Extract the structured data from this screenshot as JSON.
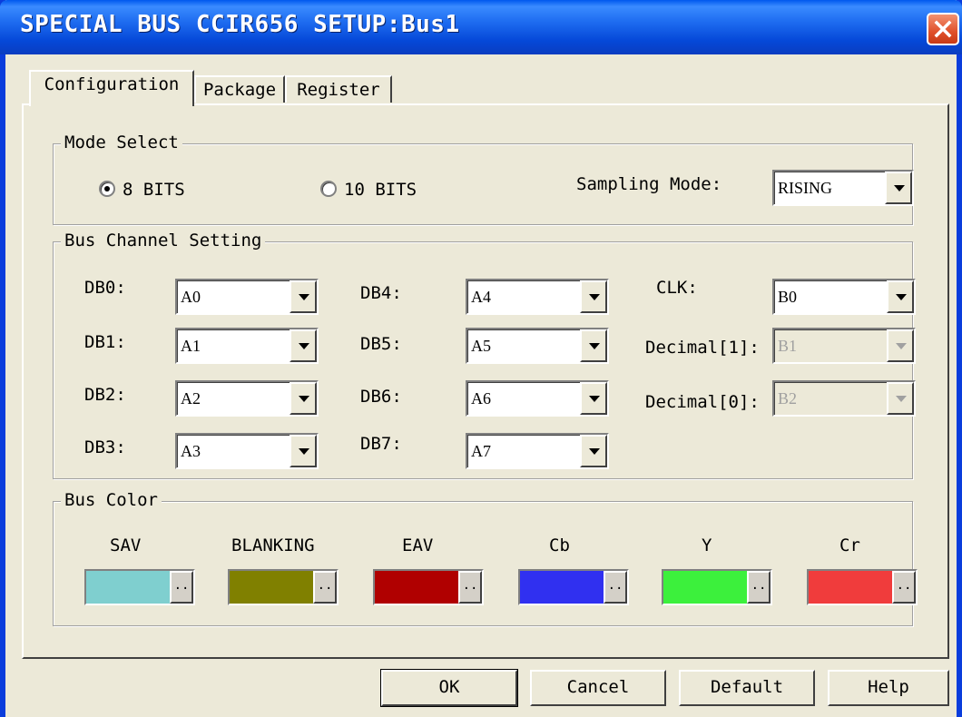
{
  "window": {
    "title": "SPECIAL BUS CCIR656 SETUP:Bus1"
  },
  "tabs": [
    "Configuration",
    "Package",
    "Register"
  ],
  "mode_select": {
    "group_label": "Mode Select",
    "radio_8": "8 BITS",
    "radio_10": "10 BITS",
    "selected": "8 BITS",
    "sampling_label": "Sampling Mode:",
    "sampling_value": "RISING"
  },
  "bus_channel": {
    "group_label": "Bus Channel Setting",
    "db0": {
      "label": "DB0:",
      "value": "A0"
    },
    "db1": {
      "label": "DB1:",
      "value": "A1"
    },
    "db2": {
      "label": "DB2:",
      "value": "A2"
    },
    "db3": {
      "label": "DB3:",
      "value": "A3"
    },
    "db4": {
      "label": "DB4:",
      "value": "A4"
    },
    "db5": {
      "label": "DB5:",
      "value": "A5"
    },
    "db6": {
      "label": "DB6:",
      "value": "A6"
    },
    "db7": {
      "label": "DB7:",
      "value": "A7"
    },
    "clk": {
      "label": "CLK:",
      "value": "B0"
    },
    "dec1": {
      "label": "Decimal[1]:",
      "value": "B1"
    },
    "dec0": {
      "label": "Decimal[0]:",
      "value": "B2"
    }
  },
  "bus_color": {
    "group_label": "Bus Color",
    "button_glyph": "..",
    "sav": {
      "label": "SAV",
      "color": "#7FCFCF"
    },
    "blanking": {
      "label": "BLANKING",
      "color": "#808000"
    },
    "eav": {
      "label": "EAV",
      "color": "#B00000"
    },
    "cb": {
      "label": "Cb",
      "color": "#3030F0"
    },
    "y": {
      "label": "Y",
      "color": "#3CF03C"
    },
    "cr": {
      "label": "Cr",
      "color": "#F03C3C"
    }
  },
  "buttons": {
    "ok": "OK",
    "cancel": "Cancel",
    "default": "Default",
    "help": "Help"
  }
}
